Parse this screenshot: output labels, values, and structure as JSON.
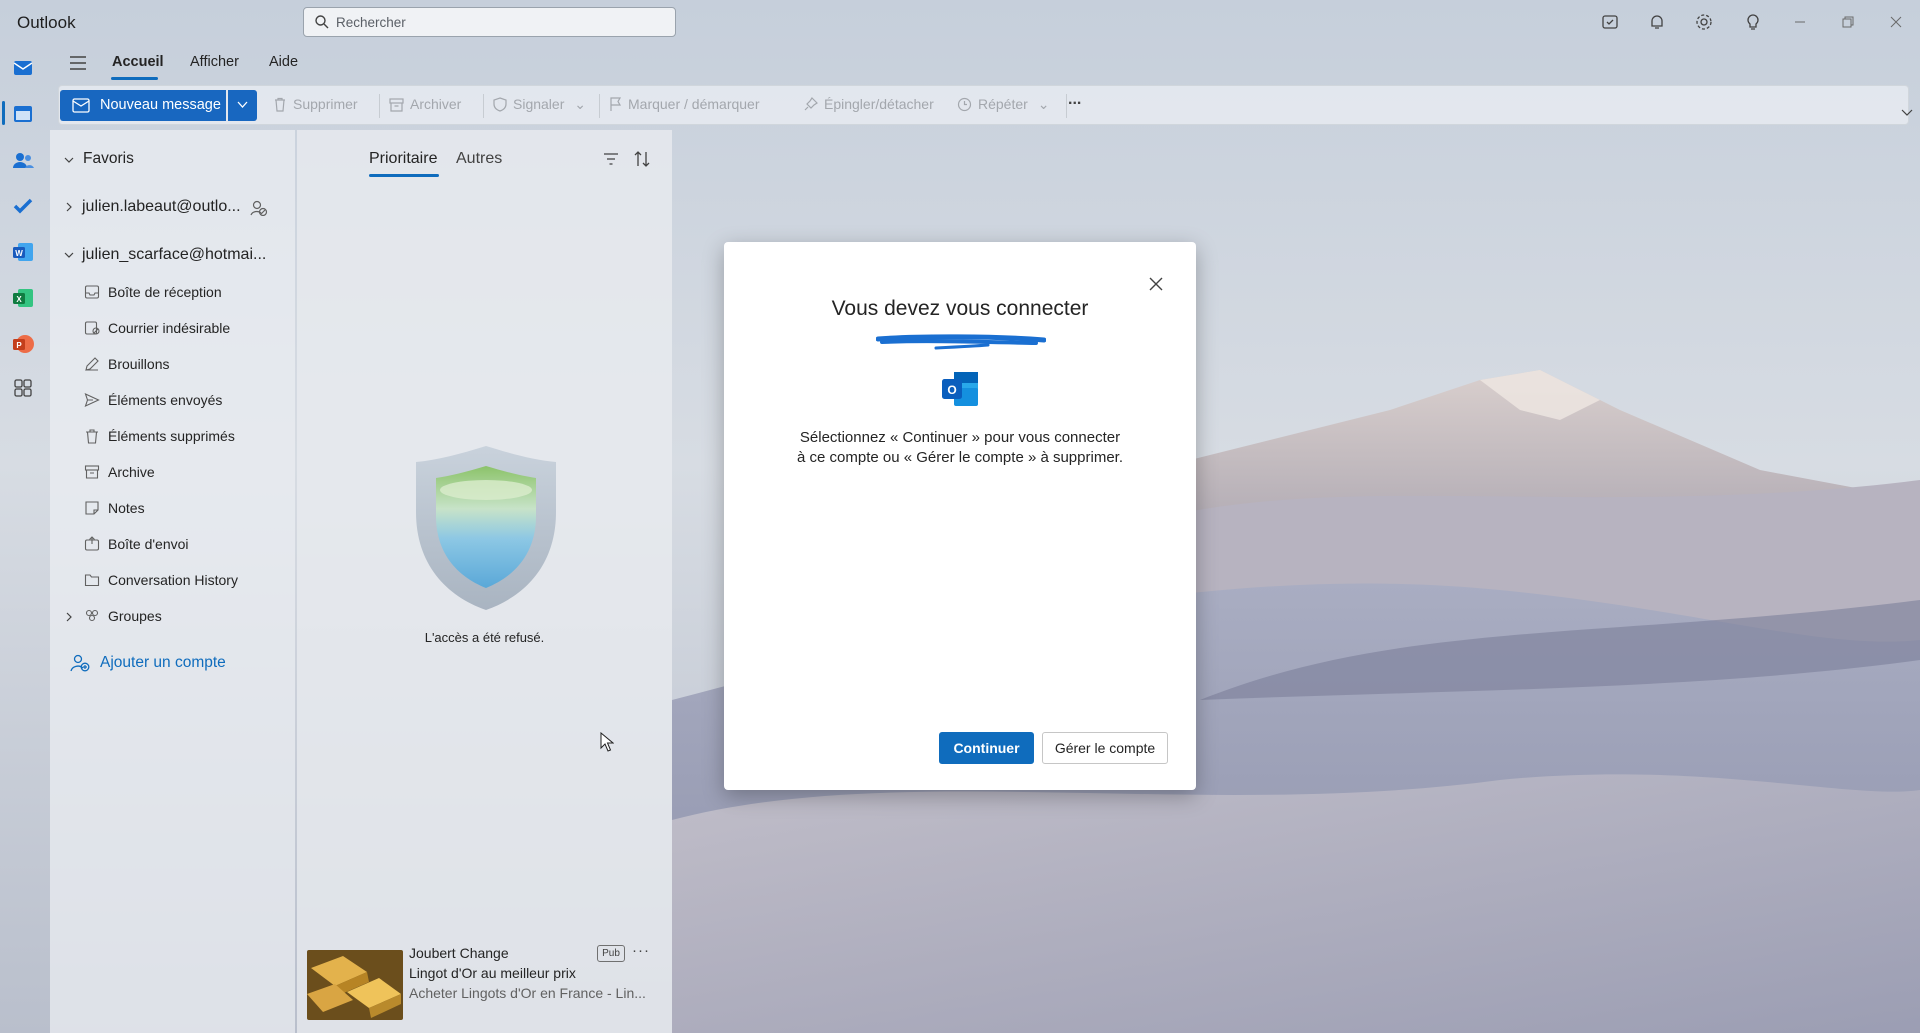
{
  "app": {
    "title": "Outlook"
  },
  "search": {
    "placeholder": "Rechercher"
  },
  "titlebar_icons": [
    "my-day-icon",
    "bell-icon",
    "gear-icon",
    "lightbulb-icon",
    "minimize-icon",
    "restore-icon",
    "close-icon"
  ],
  "rail_icons": [
    "mail-icon",
    "calendar-icon",
    "people-icon",
    "todo-icon",
    "word-icon",
    "excel-icon",
    "powerpoint-icon",
    "apps-icon"
  ],
  "ribbon": {
    "tabs": [
      "Accueil",
      "Afficher",
      "Aide"
    ],
    "new_message": "Nouveau message",
    "commands": {
      "delete": "Supprimer",
      "archive": "Archiver",
      "report": "Signaler",
      "flag": "Marquer / démarquer",
      "pin": "Épingler/détacher",
      "repeat": "Répéter",
      "more": "..."
    }
  },
  "folders": {
    "favorites": "Favoris",
    "accounts": [
      "julien.labeaut@outlo...",
      "julien_scarface@hotmai..."
    ],
    "items": [
      "Boîte de réception",
      "Courrier indésirable",
      "Brouillons",
      "Éléments envoyés",
      "Éléments supprimés",
      "Archive",
      "Notes",
      "Boîte d'envoi",
      "Conversation History",
      "Groupes"
    ],
    "add_account": "Ajouter un compte"
  },
  "message_list": {
    "tabs": [
      "Prioritaire",
      "Autres"
    ],
    "denied_text": "L'accès a été refusé.",
    "ad": {
      "sender": "Joubert Change",
      "badge": "Pub",
      "subject": "Lingot d'Or au meilleur prix",
      "preview": "Acheter Lingots d'Or en France - Lin..."
    }
  },
  "modal": {
    "title": "Vous devez vous connecter",
    "message": "Sélectionnez « Continuer » pour vous connecter à ce compte ou « Gérer le compte » à supprimer.",
    "continue": "Continuer",
    "manage": "Gérer le compte"
  },
  "colors": {
    "accent": "#0f6cbd",
    "primary_button": "#1867c0",
    "redaction": "#1a6fd1"
  }
}
